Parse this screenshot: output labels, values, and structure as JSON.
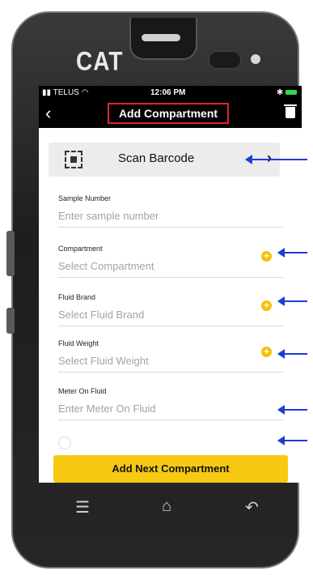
{
  "device": {
    "brand_logo": "CAT"
  },
  "status_bar": {
    "carrier": "TELUS",
    "time": "12:06 PM",
    "bluetooth": "✱"
  },
  "header": {
    "title": "Add Compartment",
    "back_icon": "chevron-left-icon",
    "delete_icon": "trash-icon"
  },
  "scan": {
    "label": "Scan Barcode",
    "chevron": "›"
  },
  "fields": [
    {
      "label": "Sample Number",
      "placeholder": "Enter sample number",
      "has_add": false
    },
    {
      "label": "Compartment",
      "placeholder": "Select Compartment",
      "has_add": true
    },
    {
      "label": "Fluid Brand",
      "placeholder": "Select Fluid Brand",
      "has_add": true
    },
    {
      "label": "Fluid Weight",
      "placeholder": "Select Fluid Weight",
      "has_add": true
    },
    {
      "label": "Meter On Fluid",
      "placeholder": "Enter Meter On Fluid",
      "has_add": false
    }
  ],
  "cta": {
    "label": "Add Next Compartment"
  },
  "nav": {
    "recent": "☰",
    "home": "⌂",
    "back": "↶"
  },
  "colors": {
    "accent": "#f7c913",
    "header_bg": "#000000",
    "highlight": "#e5232b",
    "annotation": "#1a3fd1"
  }
}
